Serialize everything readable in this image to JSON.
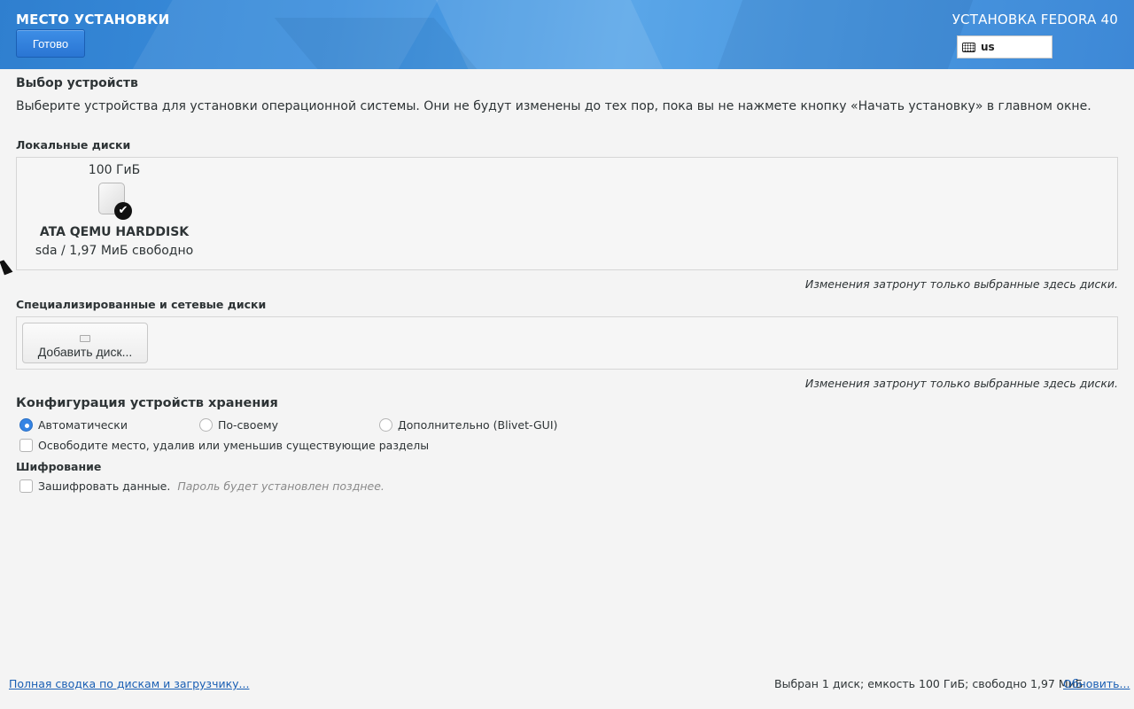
{
  "header": {
    "title": "МЕСТО УСТАНОВКИ",
    "done_label": "Готово",
    "product": "УСТАНОВКА FEDORA 40",
    "keyboard_layout": "us"
  },
  "device_selection": {
    "heading": "Выбор устройств",
    "description": "Выберите устройства для установки операционной системы. Они не будут изменены до тех пор, пока вы не нажмете кнопку «Начать установку» в главном окне."
  },
  "local_disks": {
    "heading": "Локальные диски",
    "disks": [
      {
        "size": "100 ГиБ",
        "name": "ATA QEMU HARDDISK",
        "device": "sda",
        "separator": "/",
        "free": "1,97 МиБ свободно",
        "selected": true
      }
    ],
    "note": "Изменения затронут только выбранные здесь диски."
  },
  "special_disks": {
    "heading": "Специализированные и сетевые диски",
    "add_label": "Добавить диск...",
    "note": "Изменения затронут только выбранные здесь диски."
  },
  "storage_config": {
    "heading": "Конфигурация устройств хранения",
    "options": [
      {
        "label": "Автоматически",
        "selected": true
      },
      {
        "label": "По-своему",
        "selected": false
      },
      {
        "label": "Дополнительно (Blivet-GUI)",
        "selected": false
      }
    ],
    "reclaim_label": "Освободите место, удалив или уменьшив существующие разделы"
  },
  "encryption": {
    "heading": "Шифрование",
    "encrypt_label": "Зашифровать данные.",
    "encrypt_hint": "Пароль будет установлен позднее."
  },
  "footer": {
    "summary_link": "Полная сводка по дискам и загрузчику...",
    "status": "Выбран 1 диск; емкость 100 ГиБ; свободно 1,97 МиБ",
    "refresh_link": "Обновить..."
  },
  "colors": {
    "accent": "#3584e4",
    "link": "#1a5fb4",
    "header": "#3c8fdd"
  }
}
